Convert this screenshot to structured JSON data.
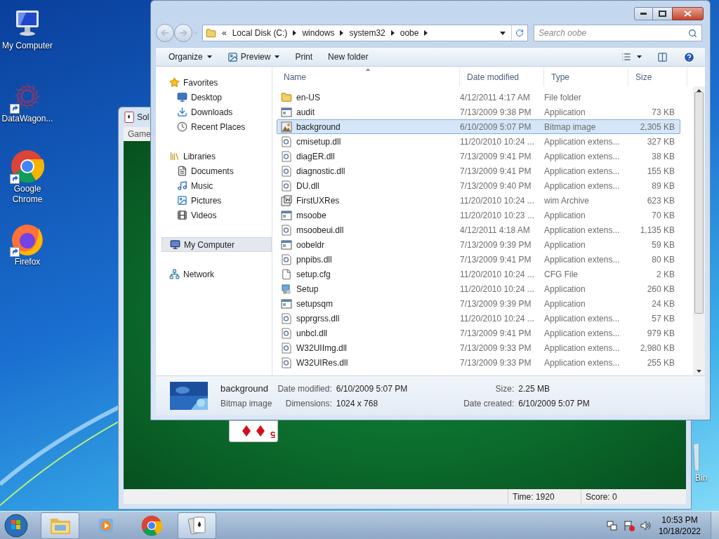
{
  "desktop_icons": [
    {
      "kind": "computer",
      "label": "My Computer",
      "shortcut": false
    },
    {
      "kind": "web",
      "label": "DataWagon...",
      "shortcut": true
    },
    {
      "kind": "chrome",
      "label": "Google Chrome",
      "shortcut": true
    },
    {
      "kind": "firefox",
      "label": "Firefox",
      "shortcut": true
    }
  ],
  "recycle_bin": {
    "label": "Bin"
  },
  "solitaire": {
    "title": "Sol",
    "menu": [
      "Game"
    ],
    "card": {
      "rank": "5"
    },
    "status": {
      "time": "Time: 1920",
      "score": "Score: 0"
    }
  },
  "explorer": {
    "address": {
      "overflow": "«",
      "crumbs": [
        "Local Disk (C:)",
        "windows",
        "system32",
        "oobe"
      ]
    },
    "search": {
      "placeholder": "Search oobe"
    },
    "toolbar": [
      {
        "label": "Organize",
        "kind": "menu",
        "icon": false
      },
      {
        "label": "Preview",
        "kind": "menu",
        "icon": true
      },
      {
        "label": "Print",
        "kind": "plain",
        "icon": false
      },
      {
        "label": "New folder",
        "kind": "plain",
        "icon": false
      }
    ],
    "nav": [
      {
        "kind": "favorites",
        "label": "Favorites",
        "selected": false,
        "children": [
          {
            "kind": "desktop",
            "label": "Desktop",
            "selected": false
          },
          {
            "kind": "downloads",
            "label": "Downloads",
            "selected": false
          },
          {
            "kind": "recent",
            "label": "Recent Places",
            "selected": false
          }
        ]
      },
      {
        "kind": "libraries",
        "label": "Libraries",
        "selected": false,
        "children": [
          {
            "kind": "documents",
            "label": "Documents",
            "selected": false
          },
          {
            "kind": "music",
            "label": "Music",
            "selected": false
          },
          {
            "kind": "pictures",
            "label": "Pictures",
            "selected": false
          },
          {
            "kind": "videos",
            "label": "Videos",
            "selected": false
          }
        ]
      },
      {
        "kind": "computer",
        "label": "My Computer",
        "selected": true
      },
      {
        "kind": "network",
        "label": "Network",
        "selected": false
      }
    ],
    "columns": [
      {
        "label": "Name",
        "sorted": true
      },
      {
        "label": "Date modified",
        "sorted": false
      },
      {
        "label": "Type",
        "sorted": false
      },
      {
        "label": "Size",
        "sorted": false
      }
    ],
    "files": [
      {
        "kind": "folder",
        "name": "en-US",
        "date": "4/12/2011 4:17 AM",
        "type": "File folder",
        "selected": false
      },
      {
        "kind": "app",
        "name": "audit",
        "date": "7/13/2009 9:38 PM",
        "type": "Application",
        "size": "73 KB",
        "selected": false
      },
      {
        "kind": "bitmap",
        "name": "background",
        "date": "6/10/2009 5:07 PM",
        "type": "Bitmap image",
        "size": "2,305 KB",
        "selected": true
      },
      {
        "kind": "dll",
        "name": "cmisetup.dll",
        "date": "11/20/2010 10:24 ...",
        "type": "Application extens...",
        "size": "327 KB",
        "selected": false
      },
      {
        "kind": "dll",
        "name": "diagER.dll",
        "date": "7/13/2009 9:41 PM",
        "type": "Application extens...",
        "size": "38 KB",
        "selected": false
      },
      {
        "kind": "dll",
        "name": "diagnostic.dll",
        "date": "7/13/2009 9:41 PM",
        "type": "Application extens...",
        "size": "155 KB",
        "selected": false
      },
      {
        "kind": "dll",
        "name": "DU.dll",
        "date": "7/13/2009 9:40 PM",
        "type": "Application extens...",
        "size": "89 KB",
        "selected": false
      },
      {
        "kind": "wim",
        "name": "FirstUXRes",
        "date": "11/20/2010 10:24 ...",
        "type": "wim Archive",
        "size": "623 KB",
        "selected": false
      },
      {
        "kind": "app",
        "name": "msoobe",
        "date": "11/20/2010 10:23 ...",
        "type": "Application",
        "size": "70 KB",
        "selected": false
      },
      {
        "kind": "dll",
        "name": "msoobeui.dll",
        "date": "4/12/2011 4:18 AM",
        "type": "Application extens...",
        "size": "1,135 KB",
        "selected": false
      },
      {
        "kind": "app",
        "name": "oobeldr",
        "date": "7/13/2009 9:39 PM",
        "type": "Application",
        "size": "59 KB",
        "selected": false
      },
      {
        "kind": "dll",
        "name": "pnpibs.dll",
        "date": "7/13/2009 9:41 PM",
        "type": "Application extens...",
        "size": "80 KB",
        "selected": false
      },
      {
        "kind": "cfg",
        "name": "setup.cfg",
        "date": "11/20/2010 10:24 ...",
        "type": "CFG File",
        "size": "2 KB",
        "selected": false
      },
      {
        "kind": "setup",
        "name": "Setup",
        "date": "11/20/2010 10:24 ...",
        "type": "Application",
        "size": "260 KB",
        "selected": false
      },
      {
        "kind": "app",
        "name": "setupsqm",
        "date": "7/13/2009 9:39 PM",
        "type": "Application",
        "size": "24 KB",
        "selected": false
      },
      {
        "kind": "dll",
        "name": "spprgrss.dll",
        "date": "11/20/2010 10:24 ...",
        "type": "Application extens...",
        "size": "57 KB",
        "selected": false
      },
      {
        "kind": "dll",
        "name": "unbcl.dll",
        "date": "7/13/2009 9:41 PM",
        "type": "Application extens...",
        "size": "979 KB",
        "selected": false
      },
      {
        "kind": "dll",
        "name": "W32UIImg.dll",
        "date": "7/13/2009 9:33 PM",
        "type": "Application extens...",
        "size": "2,980 KB",
        "selected": false
      },
      {
        "kind": "dll",
        "name": "W32UIRes.dll",
        "date": "7/13/2009 9:33 PM",
        "type": "Application extens...",
        "size": "255 KB",
        "selected": false
      }
    ],
    "details": {
      "name": "background",
      "type": "Bitmap image",
      "fields": [
        {
          "label": "Date modified:",
          "value": "6/10/2009 5:07 PM"
        },
        {
          "label": "Size:",
          "value": "2.25 MB"
        },
        {
          "label": "Dimensions:",
          "value": "1024 x 768"
        },
        {
          "label": "Date created:",
          "value": "6/10/2009 5:07 PM"
        }
      ]
    }
  },
  "taskbar": {
    "items": [
      {
        "kind": "explorer",
        "active": true
      },
      {
        "kind": "media",
        "active": false
      },
      {
        "kind": "chrome",
        "active": false
      },
      {
        "kind": "solitaire",
        "active": true
      }
    ],
    "clock": {
      "time": "10:53 PM",
      "date": "10/18/2022"
    }
  }
}
